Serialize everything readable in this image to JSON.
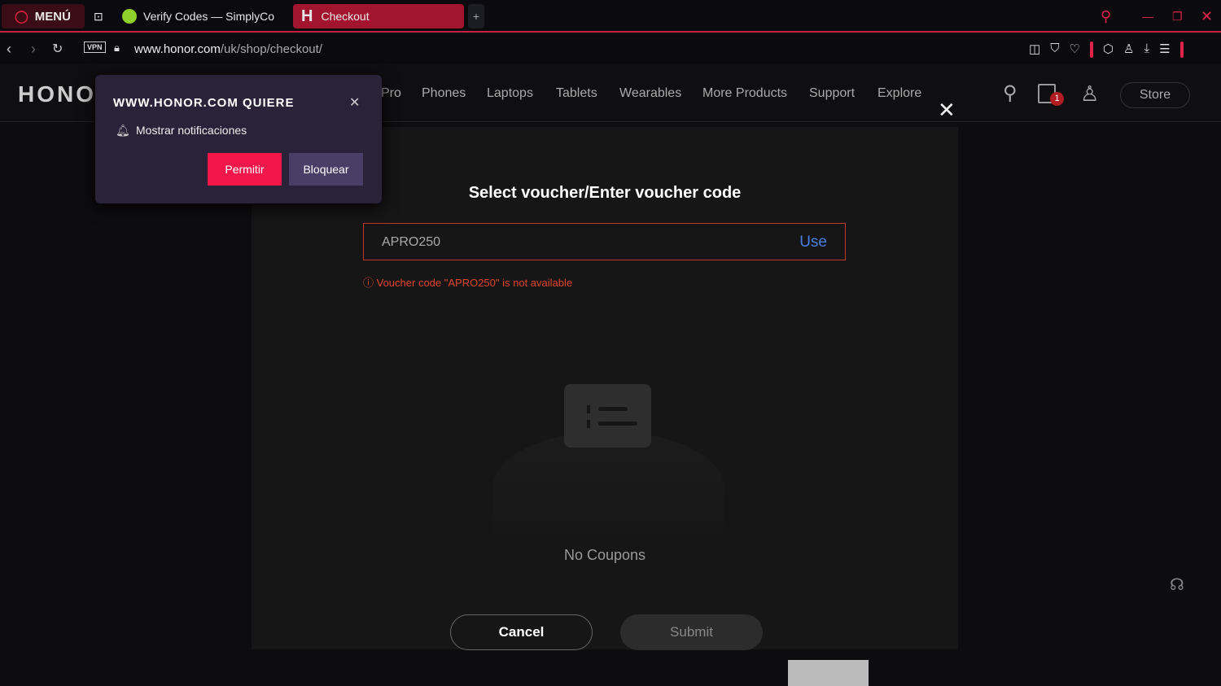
{
  "browser": {
    "menu_label": "MENÚ",
    "tabs": [
      {
        "label": "Verify Codes — SimplyCo"
      },
      {
        "label": "Checkout",
        "icon": "H"
      }
    ],
    "url_host": "www.honor.com",
    "url_path": "/uk/shop/checkout/",
    "vpn": "VPN"
  },
  "site": {
    "logo": "HONO",
    "nav": [
      "Pro",
      "Phones",
      "Laptops",
      "Tablets",
      "Wearables",
      "More Products",
      "Support",
      "Explore"
    ],
    "cart_count": "1",
    "store": "Store"
  },
  "popup": {
    "title": "WWW.HONOR.COM QUIERE",
    "message": "Mostrar notificaciones",
    "allow": "Permitir",
    "block": "Bloquear"
  },
  "modal": {
    "title": "Select voucher/Enter voucher code",
    "code": "APRO250",
    "use": "Use",
    "error": "Voucher code \"APRO250\" is not available",
    "empty": "No Coupons",
    "cancel": "Cancel",
    "submit": "Submit"
  },
  "colors": {
    "accent": "#c8203f",
    "error": "#e0452c",
    "link": "#4a7fe0"
  }
}
